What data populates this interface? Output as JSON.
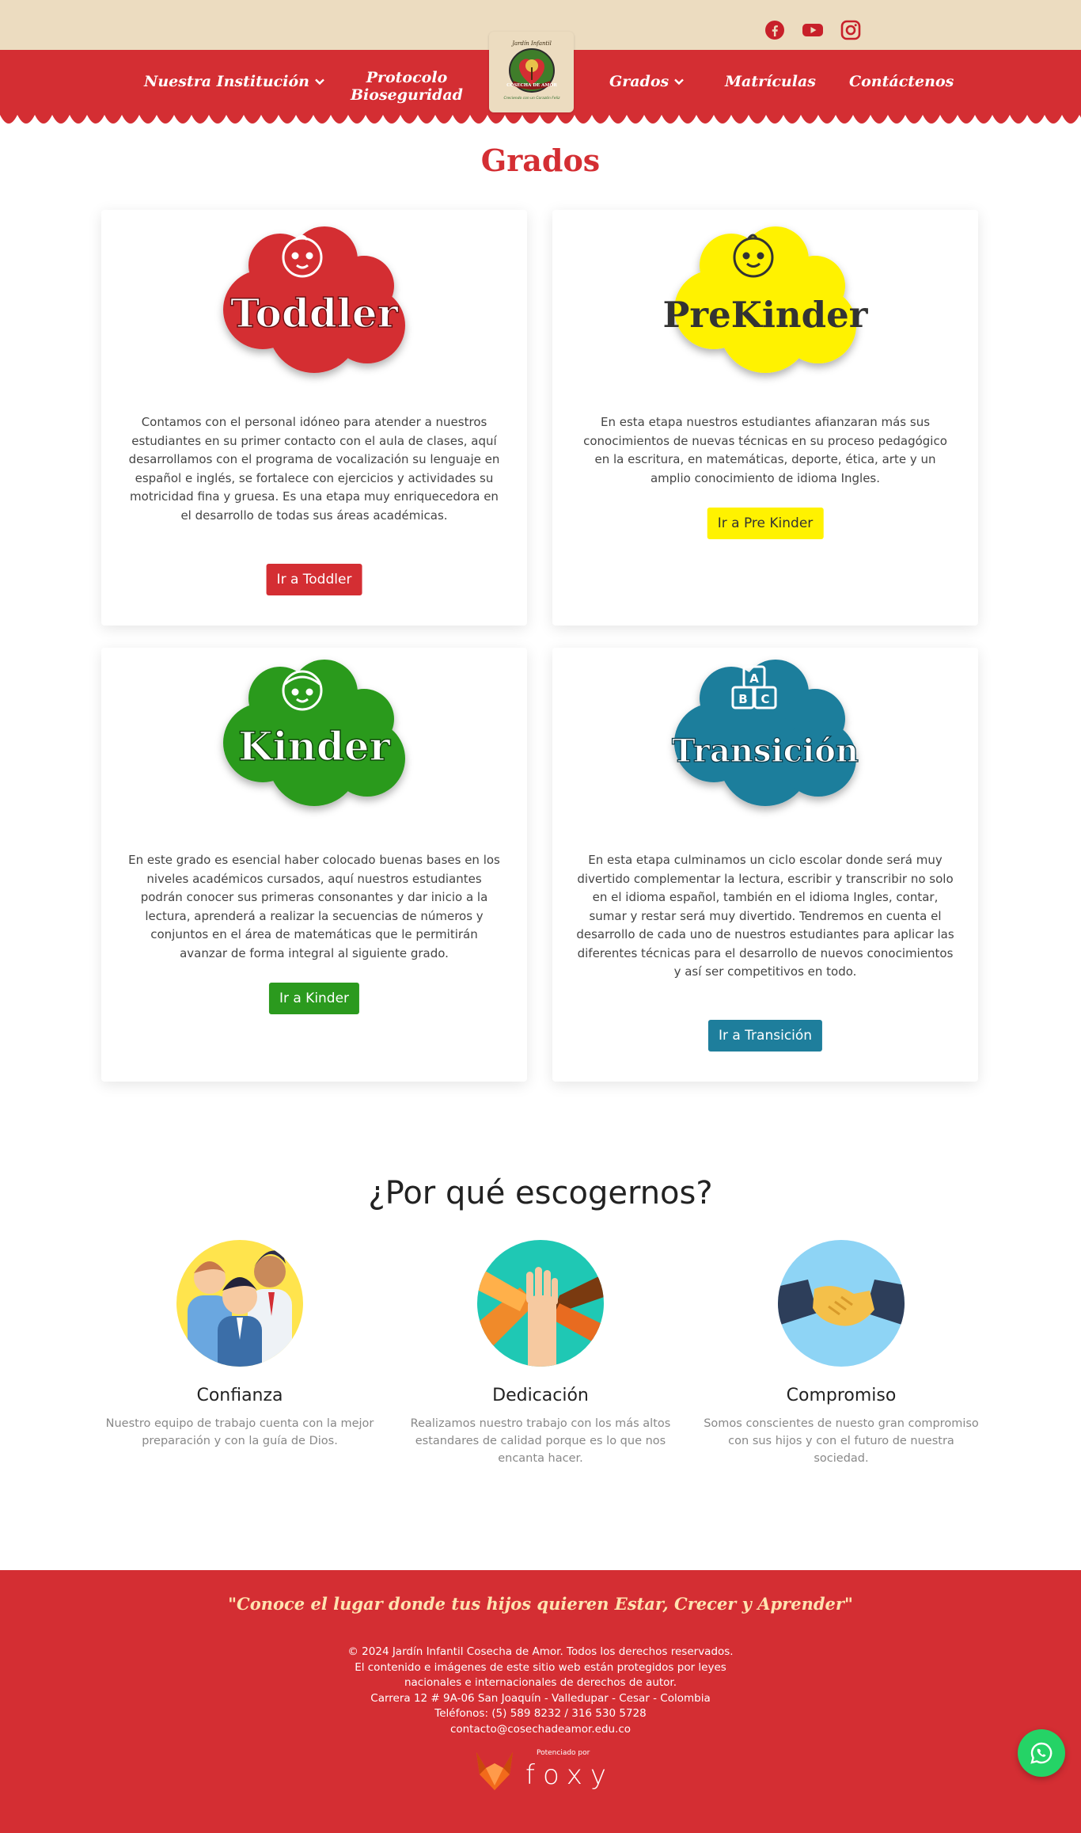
{
  "nav": {
    "institution": "Nuestra Institución",
    "protocol_line1": "Protocolo",
    "protocol_line2": "Bioseguridad",
    "grades": "Grados",
    "enrollment": "Matrículas",
    "contact": "Contáctenos"
  },
  "logo": {
    "top_text": "Jardín Infantil",
    "name": "COSECHA DE AMOR",
    "tagline": "Creciendo con un Corazón Feliz"
  },
  "social": [
    "facebook-icon",
    "youtube-icon",
    "instagram-icon"
  ],
  "page_title": "Grados",
  "cards": [
    {
      "badge": "Toddler",
      "color": "#d42e33",
      "text": "Contamos con el personal idóneo para atender a nuestros estudiantes en su primer contacto con el aula de clases, aquí desarrollamos con el programa de vocalización su lenguaje en español e inglés, se fortalece con ejercicios y actividades su motricidad fina y gruesa. Es una etapa muy enriquecedora en el desarrollo de todas sus áreas académicas.",
      "button": "Ir a Toddler"
    },
    {
      "badge": "PreKinder",
      "color": "#fff200",
      "text": "En esta etapa nuestros estudiantes afianzaran más sus conocimientos de nuevas técnicas en su proceso pedagógico en la escritura, en matemáticas, deporte, ética, arte y un amplio conocimiento  de idioma Ingles.",
      "button": "Ir a Pre Kinder"
    },
    {
      "badge": "Kinder",
      "color": "#2b9a1e",
      "text": "En este grado es esencial haber colocado buenas bases en los niveles académicos cursados, aquí nuestros estudiantes podrán conocer sus primeras consonantes y dar inicio a la lectura, aprenderá a realizar la secuencias de números y conjuntos en el área de matemáticas que le permitirán avanzar de forma integral al siguiente grado.",
      "button": "Ir a Kinder"
    },
    {
      "badge": "Transición",
      "color": "#1e7e9c",
      "text": "En esta etapa culminamos un ciclo escolar donde será muy divertido complementar la lectura, escribir y transcribir no solo en el idioma español, también en el idioma Ingles, contar, sumar y  restar será muy divertido. Tendremos en cuenta el desarrollo de cada uno de nuestros estudiantes para aplicar las diferentes técnicas para el desarrollo de nuevos conocimientos y así ser competitivos en todo.",
      "button": "Ir a Transición"
    }
  ],
  "why": {
    "title": "¿Por qué escogernos?",
    "items": [
      {
        "title": "Confianza",
        "text": "Nuestro equipo de trabajo cuenta con la mejor preparación y con la guía de Dios."
      },
      {
        "title": "Dedicación",
        "text": "Realizamos nuestro trabajo con los más altos estandares de calidad porque es lo que nos encanta hacer."
      },
      {
        "title": "Compromiso",
        "text": "Somos conscientes de nuesto gran compromiso con sus hijos y con el futuro de nuestra sociedad."
      }
    ]
  },
  "footer": {
    "quote": "\"Conoce el lugar donde tus hijos quieren Estar, Crecer y Aprender\"",
    "lines": [
      "© 2024 Jardín Infantil Cosecha de Amor. Todos los derechos reservados.",
      "El contenido e imágenes de este sitio web están protegidos por leyes",
      "nacionales e internacionales de derechos de autor.",
      "Carrera 12 # 9A-06 San Joaquín - Valledupar - Cesar - Colombia",
      "Teléfonos: (5) 589 8232 / 316 530 5728",
      "contacto@cosechadeamor.edu.co"
    ],
    "powered_by": "Potenciado por",
    "brand": "foxy"
  }
}
